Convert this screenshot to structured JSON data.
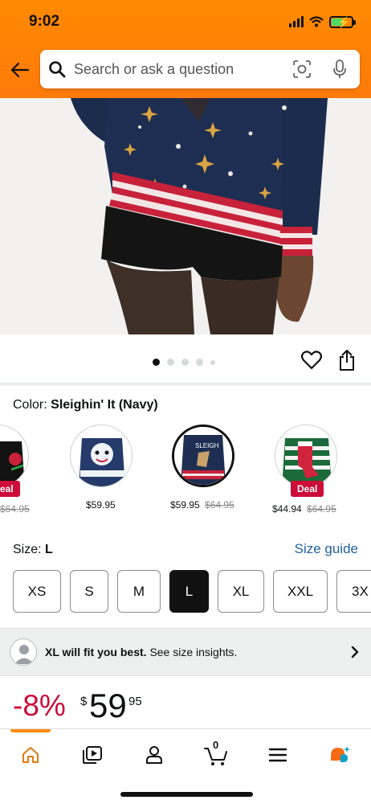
{
  "status_bar": {
    "time": "9:02",
    "battery_level": 0.55
  },
  "search": {
    "placeholder": "Search or ask a question"
  },
  "gallery": {
    "image_count": 5,
    "active_index": 0
  },
  "color": {
    "label": "Color:",
    "value": "Sleighin' It (Navy)"
  },
  "swatches": [
    {
      "price": "",
      "list_price": "$64.95",
      "deal": "eal"
    },
    {
      "price": "$59.95",
      "list_price": "",
      "deal": ""
    },
    {
      "price": "$59.95",
      "list_price": "$64.95",
      "deal": "",
      "selected": true
    },
    {
      "price": "$44.94",
      "list_price": "$64.95",
      "deal": "Deal"
    }
  ],
  "size": {
    "label": "Size:",
    "value": "L",
    "guide_label": "Size guide",
    "options": [
      "XS",
      "S",
      "M",
      "L",
      "XL",
      "XXL",
      "3X"
    ]
  },
  "fit": {
    "bold": "XL will fit you best.",
    "rest": "See size insights."
  },
  "pricing": {
    "discount": "-8%",
    "currency": "$",
    "whole": "59",
    "fraction": "95"
  },
  "nav": {
    "cart_count": "0"
  },
  "colors": {
    "accent": "#ff8a00",
    "deal": "#cc0c39",
    "link": "#2162a1",
    "navy": "#1c2c4c"
  }
}
